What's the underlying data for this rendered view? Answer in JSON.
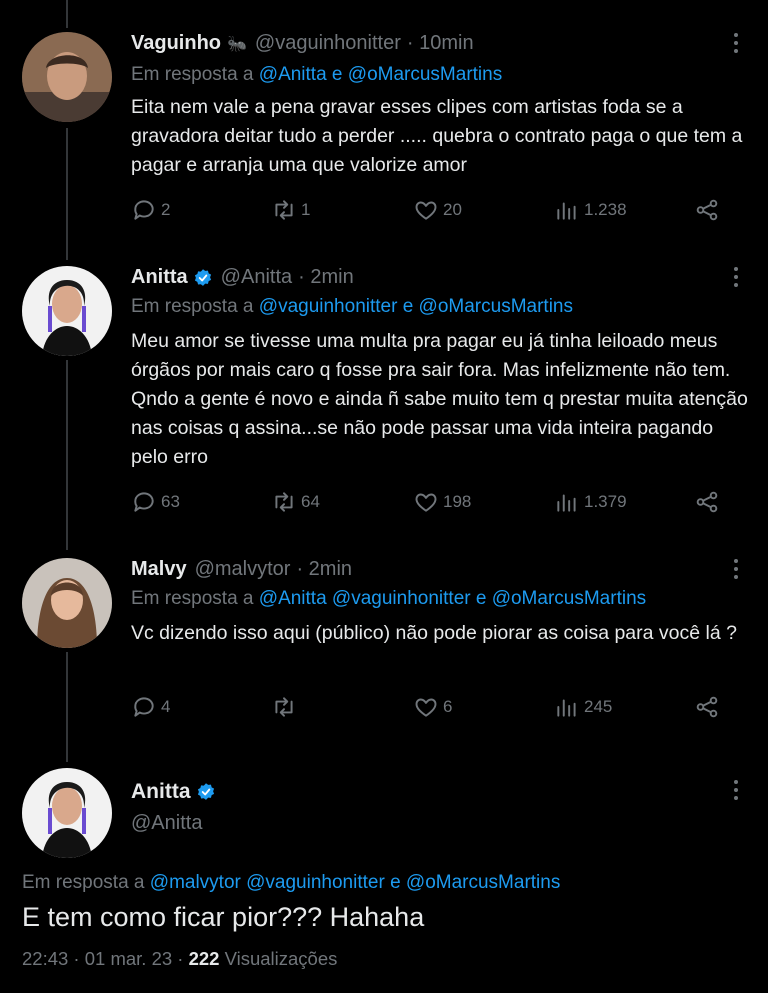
{
  "tweets": [
    {
      "name": "Vaguinho",
      "name_emoji": "🐜",
      "handle": "@vaguinhonitter",
      "time": "· 10min",
      "reply_prefix": "Em resposta a",
      "reply_mentions": "@Anitta e @oMarcusMartins",
      "text": "Eita nem vale a pena gravar esses clipes com artistas foda se a gravadora deitar tudo a perder ..... quebra o contrato paga o que tem a pagar e arranja uma que valorize amor",
      "replies": "2",
      "retweets": "1",
      "likes": "20",
      "views": "1.238",
      "verified": false
    },
    {
      "name": "Anitta",
      "handle": "@Anitta",
      "time": "· 2min",
      "reply_prefix": "Em resposta a",
      "reply_mentions": "@vaguinhonitter e @oMarcusMartins",
      "text": "Meu amor se tivesse uma multa pra pagar eu já tinha leiloado meus órgãos por mais caro q fosse pra sair fora. Mas infelizmente não tem. Qndo a gente é novo e ainda ñ sabe muito tem q prestar muita atenção nas coisas q assina...se não pode passar uma vida inteira pagando pelo erro",
      "replies": "63",
      "retweets": "64",
      "likes": "198",
      "views": "1.379",
      "verified": true
    },
    {
      "name": "Malvy",
      "handle": "@malvytor",
      "time": "· 2min",
      "reply_prefix": "Em resposta a",
      "reply_mentions": "@Anitta @vaguinhonitter e @oMarcusMartins",
      "text": "Vc dizendo isso aqui (público) não pode piorar as coisa para você lá ?",
      "replies": "4",
      "retweets": "",
      "likes": "6",
      "views": "245",
      "verified": false
    }
  ],
  "main": {
    "name": "Anitta",
    "handle": "@Anitta",
    "reply_prefix": "Em resposta a",
    "reply_mentions": "@malvytor @vaguinhonitter e @oMarcusMartins",
    "text": "E tem como ficar pior??? Hahaha",
    "time": "22:43 · 01 mar. 23 ·",
    "views_count": "222",
    "views_label": "Visualizações"
  },
  "colors": {
    "accent": "#1d9bf0",
    "muted": "#71767b",
    "text": "#e7e9ea",
    "background": "#000000"
  },
  "icons": [
    "reply-icon",
    "retweet-icon",
    "like-icon",
    "views-icon",
    "share-icon",
    "more-icon",
    "verified-badge-icon"
  ]
}
